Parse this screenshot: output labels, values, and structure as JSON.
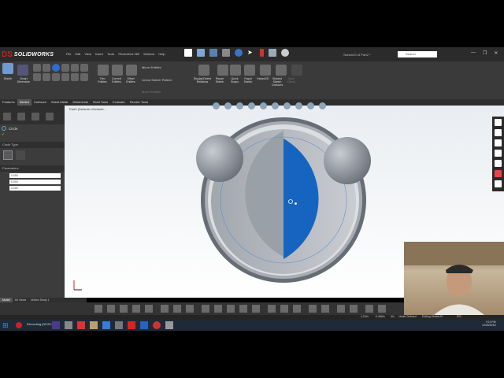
{
  "app": {
    "logo_text": "SOLIDWORKS",
    "logo_mark": "DS",
    "menu": [
      "File",
      "Edit",
      "View",
      "Insert",
      "Tools",
      "PhotoView 360",
      "Window",
      "Help"
    ],
    "document_title": "Sketch20 of Part2 *",
    "search_placeholder": "Search",
    "window_controls": [
      "—",
      "❐",
      "✕"
    ]
  },
  "ribbon": {
    "sketch_label": "Sketch",
    "smart_dimension_label": "Smart Dimension",
    "trim_label": "Trim Entities",
    "convert_label": "Convert Entities",
    "offset_label": "Offset Entities",
    "mirror_label": "Mirror Entities",
    "linear_pattern_label": "Linear Sketch Pattern",
    "move_label": "Move Entities",
    "display_relations_label": "Display/Delete Relations",
    "repair_label": "Repair Sketch",
    "quick_snaps_label": "Quick Snaps",
    "rapid_sketch_label": "Rapid Sketch",
    "instant2d_label": "Instant2D",
    "shaded_label": "Shaded Sketch Contours",
    "spell_label": "Spell Check"
  },
  "tabs": [
    "Features",
    "Sketch",
    "Surfaces",
    "Sheet Metal",
    "Weldments",
    "Mold Tools",
    "Evaluate",
    "Render Tools"
  ],
  "active_tab": "Sketch",
  "property_manager": {
    "title": "Circle",
    "section_circle_type": "Circle Type",
    "section_parameters": "Parameters",
    "fields": [
      "0.000",
      "0.000",
      "0.000"
    ]
  },
  "graphics": {
    "tree_label": "Part2 (Default<<Default>...",
    "accent_blue": "#1565c0"
  },
  "bottom_tabs": [
    "Model",
    "3D Views",
    "Motion Study 1"
  ],
  "active_bottom_tab": "Model",
  "status": {
    "x": "4.22in",
    "y": "-0.466in",
    "z": "0in",
    "state": "Under Defined",
    "editing": "Editing Sketch20",
    "units": "IPS"
  },
  "taskbar": {
    "recording": "Recording [00:23:41]",
    "time": "7:01 PM",
    "date": "12/25/2016"
  }
}
